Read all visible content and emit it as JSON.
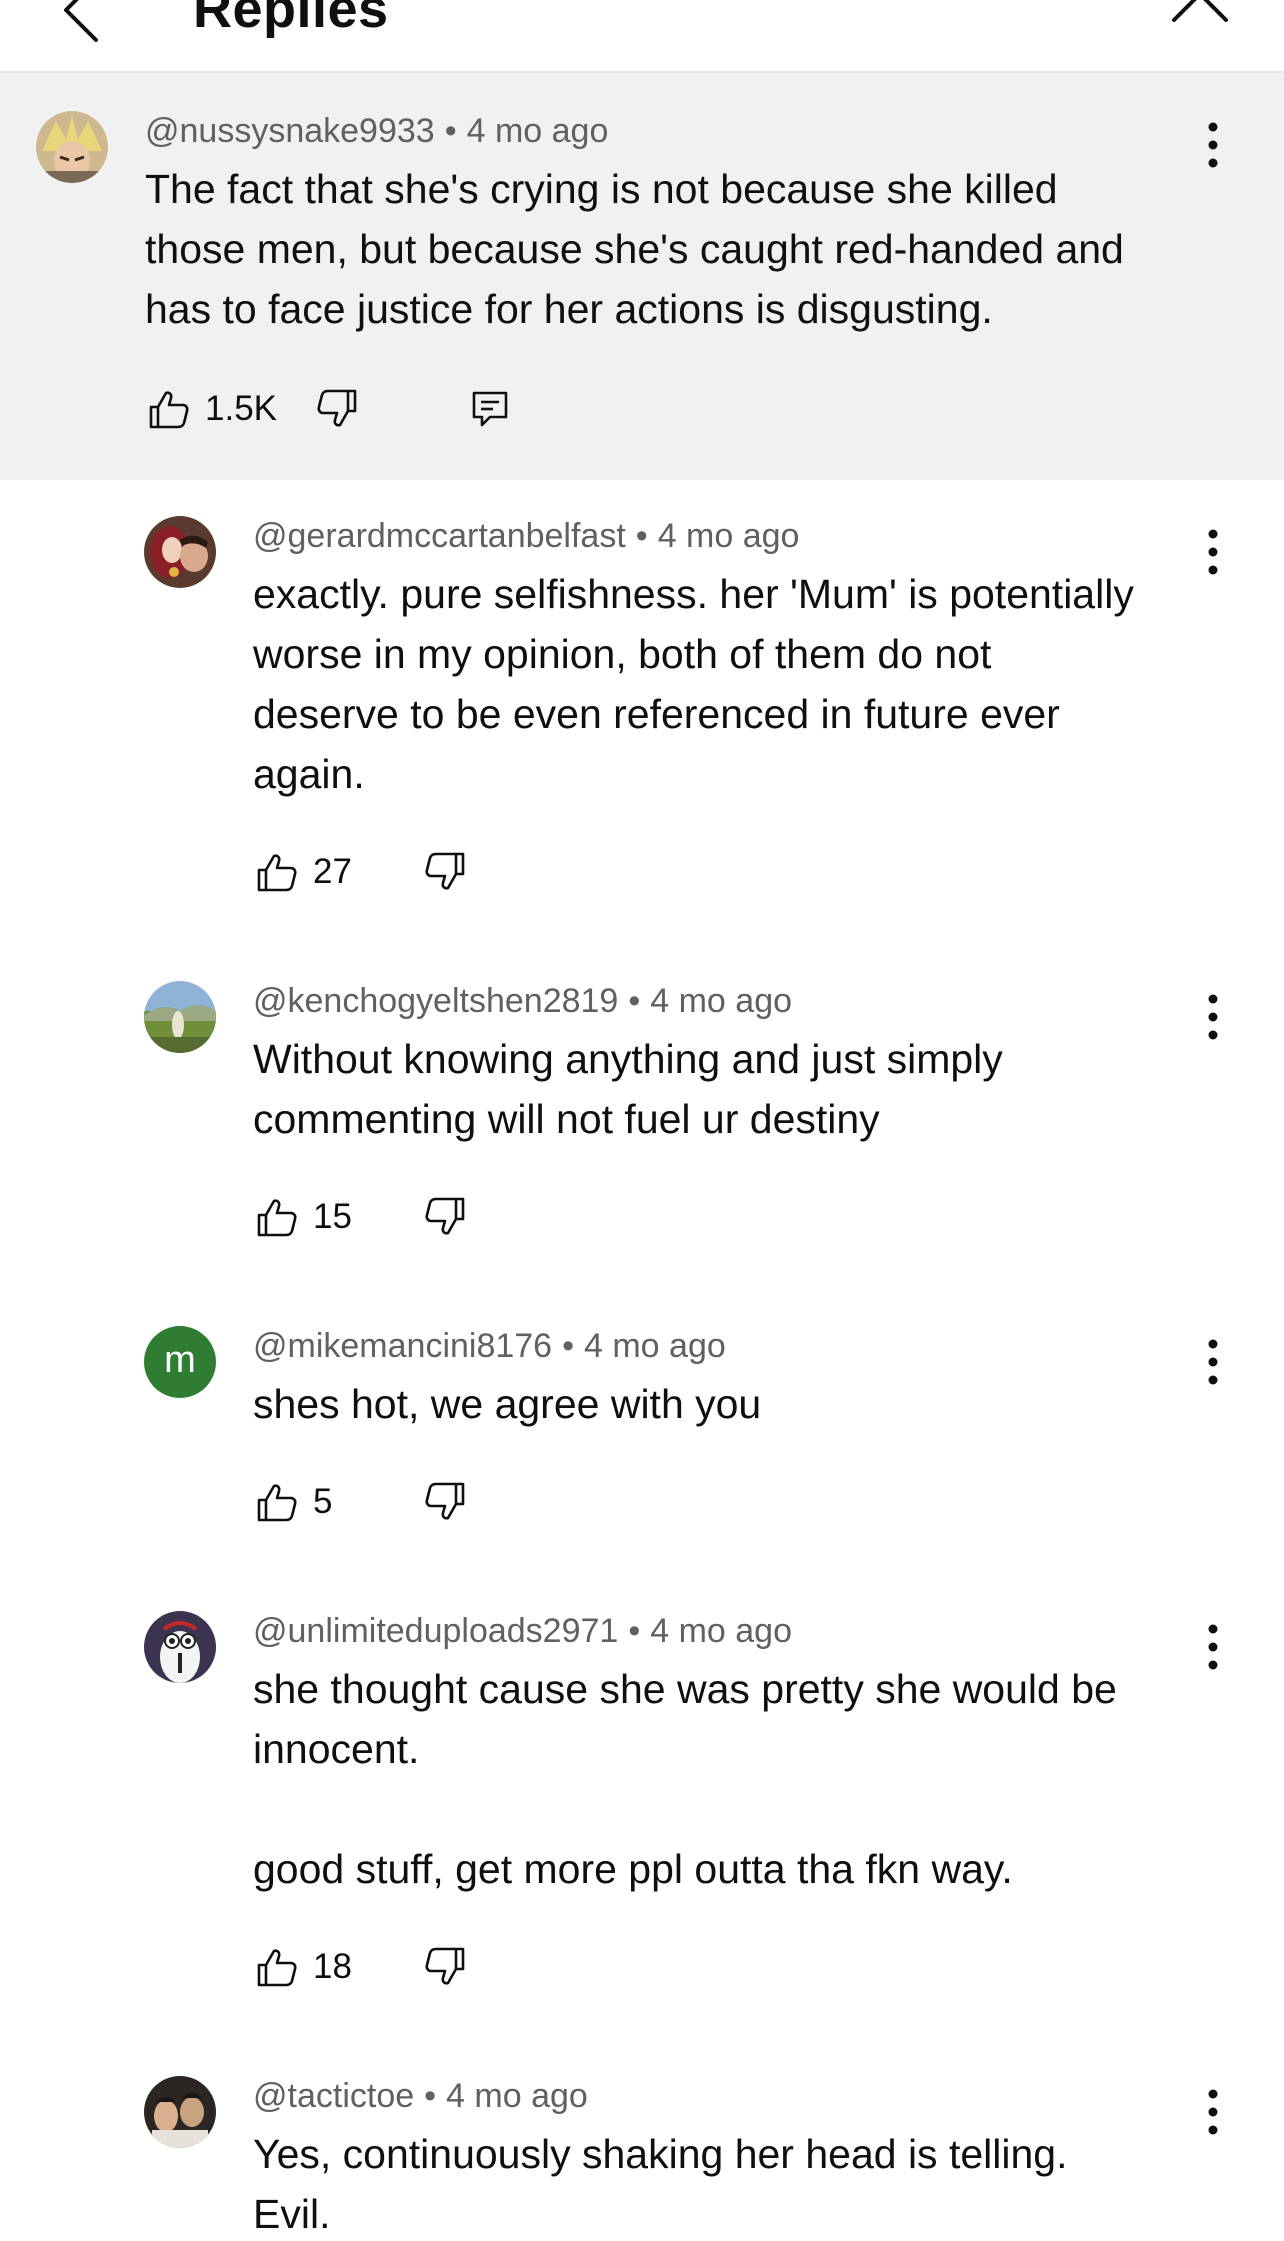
{
  "header": {
    "title": "Replies",
    "back_icon": "chevron-left-icon",
    "close_icon": "close-icon"
  },
  "colors": {
    "pinned_bg": "#f1f1f1",
    "meta_text": "#606060",
    "avatar_m": "#2e7d32"
  },
  "comments": [
    {
      "author": "@nussysnake9933",
      "time": "4 mo ago",
      "text": "The fact that she's crying is not because she killed\nthose men, but because she's caught red-handed and\nhas to face justice for her actions is disgusting.",
      "likes": "1.5K",
      "has_reply_icon": true
    },
    {
      "author": "@gerardmccartanbelfast",
      "time": "4 mo ago",
      "text": "exactly. pure selfishness. her 'Mum' is potentially\nworse in my opinion, both of them do not\ndeserve to be even referenced in future ever\nagain.",
      "likes": "27"
    },
    {
      "author": "@kenchogyeltshen2819",
      "time": "4 mo ago",
      "text": "Without knowing anything and just simply\ncommenting will not fuel ur destiny",
      "likes": "15"
    },
    {
      "author": "@mikemancini8176",
      "time": "4 mo ago",
      "text": "shes hot, we agree with you",
      "likes": "5",
      "avatar_letter": "m"
    },
    {
      "author": "@unlimiteduploads2971",
      "time": "4 mo ago",
      "text": "she thought cause she was pretty she would be\ninnocent.\n\ngood stuff, get more ppl outta tha fkn way.",
      "likes": "18"
    },
    {
      "author": "@tactictoe",
      "time": "4 mo ago",
      "text": "Yes, continuously shaking her head is telling.\nEvil.",
      "likes": ""
    }
  ]
}
